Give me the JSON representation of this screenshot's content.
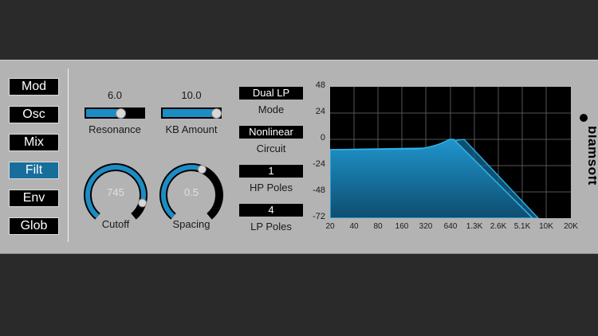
{
  "nav": [
    {
      "label": "Mod",
      "active": false
    },
    {
      "label": "Osc",
      "active": false
    },
    {
      "label": "Mix",
      "active": false
    },
    {
      "label": "Filt",
      "active": true
    },
    {
      "label": "Env",
      "active": false
    },
    {
      "label": "Glob",
      "active": false
    }
  ],
  "sliders": {
    "resonance": {
      "value_text": "6.0",
      "label": "Resonance",
      "level": 0.6
    },
    "kb_amount": {
      "value_text": "10.0",
      "label": "KB Amount",
      "level": 1.0
    }
  },
  "knobs": {
    "cutoff": {
      "value_text": "745",
      "label": "Cutoff",
      "level": 0.88
    },
    "spacing": {
      "value_text": "0.5",
      "label": "Spacing",
      "level": 0.58
    }
  },
  "selectors": {
    "mode": {
      "value": "Dual LP",
      "label": "Mode"
    },
    "circuit": {
      "value": "Nonlinear",
      "label": "Circuit"
    },
    "hp_poles": {
      "value": "1",
      "label": "HP Poles"
    },
    "lp_poles": {
      "value": "4",
      "label": "LP Poles"
    }
  },
  "graph": {
    "y_ticks": [
      "48",
      "24",
      "0",
      "-24",
      "-48",
      "-72"
    ],
    "x_ticks": [
      "20",
      "40",
      "80",
      "160",
      "320",
      "640",
      "1.3K",
      "2.6K",
      "5.1K",
      "10K",
      "20K"
    ]
  },
  "brand": {
    "name": "blamsoft"
  },
  "colors": {
    "accent": "#1c8dc4",
    "active_tab": "#176e9b",
    "panel": "#b3b3b3",
    "background": "#2a2a2a"
  }
}
